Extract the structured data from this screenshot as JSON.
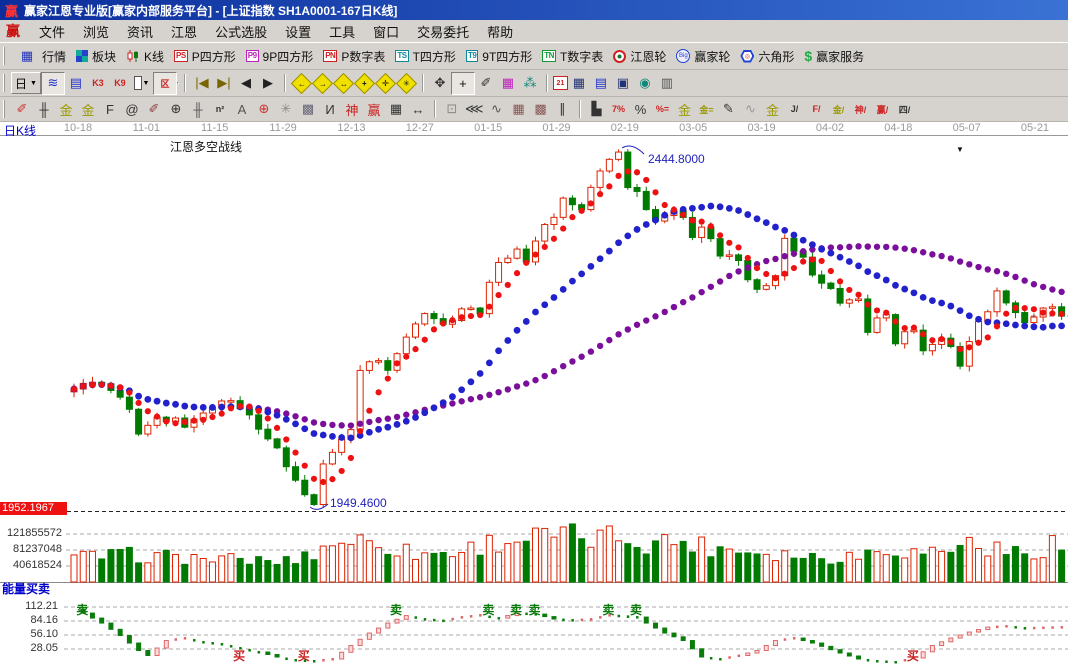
{
  "window": {
    "logo": "赢",
    "title": "赢家江恩专业版[赢家内部服务平台] - [上证指数  SH1A0001-167日K线]"
  },
  "menu": {
    "logo": "赢",
    "items": [
      "文件",
      "浏览",
      "资讯",
      "江恩",
      "公式选股",
      "设置",
      "工具",
      "窗口",
      "交易委托",
      "帮助"
    ]
  },
  "toolbar1": {
    "items": [
      {
        "kind": "glyph",
        "glyph": "▦",
        "color": "#2233bb",
        "label": "行情",
        "name": "quotes"
      },
      {
        "kind": "blocks",
        "label": "板块",
        "name": "sectors"
      },
      {
        "kind": "candles",
        "label": "K线",
        "name": "kline"
      },
      {
        "kind": "box",
        "text": "PS",
        "color": "#cc2222",
        "label": "P四方形",
        "name": "p-square"
      },
      {
        "kind": "box",
        "text": "P9",
        "color": "#bb22bb",
        "label": "9P四方形",
        "name": "9p-square"
      },
      {
        "kind": "box",
        "text": "PN",
        "color": "#cc2222",
        "label": "P数字表",
        "name": "p-number"
      },
      {
        "kind": "box",
        "text": "TS",
        "color": "#118899",
        "label": "T四方形",
        "name": "t-square"
      },
      {
        "kind": "box",
        "text": "T9",
        "color": "#118899",
        "label": "9T四方形",
        "name": "9t-square"
      },
      {
        "kind": "box",
        "text": "TN",
        "color": "#119933",
        "label": "T数字表",
        "name": "t-number"
      },
      {
        "kind": "wheel",
        "label": "江恩轮",
        "name": "gann-wheel"
      },
      {
        "kind": "bigwheel",
        "text": "Big",
        "label": "赢家轮",
        "name": "winner-wheel"
      },
      {
        "kind": "hex",
        "text": "◎",
        "label": "六角形",
        "name": "hexagon"
      },
      {
        "kind": "dollar",
        "text": "$",
        "label": "赢家服务",
        "name": "winner-service"
      }
    ]
  },
  "toolbar2": {
    "period": "日",
    "dropdown": "▼",
    "items": [
      {
        "kind": "period",
        "name": "period-selector"
      },
      {
        "kind": "glyph",
        "glyph": "≋",
        "color": "#2233cc",
        "pressed": true,
        "name": "trend-chart"
      },
      {
        "kind": "glyph",
        "glyph": "▤",
        "color": "#2233cc",
        "name": "info-panel"
      },
      {
        "kind": "glyph",
        "glyph": "K3",
        "color": "#cc2222",
        "small": true,
        "name": "k3-view"
      },
      {
        "kind": "glyph",
        "glyph": "K9",
        "color": "#cc2222",
        "small": true,
        "name": "k9-view"
      },
      {
        "kind": "candledrop",
        "name": "candle-style"
      },
      {
        "kind": "glyph",
        "glyph": "区",
        "color": "#cc2222",
        "small": true,
        "pressed": true,
        "name": "zone-tool"
      },
      {
        "kind": "flag",
        "pressed": true,
        "name": "flag-tool"
      },
      {
        "kind": "sep"
      },
      {
        "kind": "glyph",
        "glyph": "|◀",
        "color": "#776600",
        "name": "go-first"
      },
      {
        "kind": "glyph",
        "glyph": "▶|",
        "color": "#776600",
        "name": "go-last"
      },
      {
        "kind": "glyph",
        "glyph": "◀",
        "color": "#222",
        "name": "prev"
      },
      {
        "kind": "glyph",
        "glyph": "▶",
        "color": "#222",
        "name": "next"
      },
      {
        "kind": "sep"
      },
      {
        "kind": "diamond",
        "glyph": "←",
        "name": "diamond-left"
      },
      {
        "kind": "diamond",
        "glyph": "→",
        "name": "diamond-right"
      },
      {
        "kind": "diamond",
        "glyph": "↔",
        "name": "diamond-expand"
      },
      {
        "kind": "diamond",
        "glyph": "+",
        "name": "diamond-plus"
      },
      {
        "kind": "diamond",
        "glyph": "✛",
        "name": "diamond-cross"
      },
      {
        "kind": "diamond",
        "glyph": "✳",
        "name": "diamond-star"
      },
      {
        "kind": "sep"
      },
      {
        "kind": "glyph",
        "glyph": "✥",
        "color": "#333",
        "name": "hand-tool"
      },
      {
        "kind": "glyph",
        "glyph": "+",
        "color": "#111",
        "pressed": true,
        "name": "crosshair-tool"
      },
      {
        "kind": "glyph",
        "glyph": "✐",
        "color": "#333",
        "name": "lasso-tool"
      },
      {
        "kind": "glyph",
        "glyph": "▦",
        "color": "#bb22bb",
        "name": "pattern-tool"
      },
      {
        "kind": "glyph",
        "glyph": "⁂",
        "color": "#118877",
        "name": "group-tool"
      },
      {
        "kind": "sep"
      },
      {
        "kind": "calendar",
        "text": "21",
        "name": "calendar"
      },
      {
        "kind": "glyph",
        "glyph": "▦",
        "color": "#223377",
        "name": "calculator"
      },
      {
        "kind": "glyph",
        "glyph": "▤",
        "color": "#2233cc",
        "name": "notepad"
      },
      {
        "kind": "glyph",
        "glyph": "▣",
        "color": "#223377",
        "name": "save"
      },
      {
        "kind": "glyph",
        "glyph": "◉",
        "color": "#118877",
        "name": "export"
      },
      {
        "kind": "glyph",
        "glyph": "▥",
        "color": "#555",
        "name": "print"
      }
    ]
  },
  "toolbar3": {
    "items": [
      {
        "kind": "glyph",
        "glyph": "✐",
        "color": "#cc3333",
        "name": "draw-pen"
      },
      {
        "kind": "glyph",
        "glyph": "╫",
        "color": "#333",
        "name": "draw-ruler"
      },
      {
        "kind": "glyph",
        "glyph": "金",
        "color": "#999900",
        "name": "draw-gold-grid1"
      },
      {
        "kind": "glyph",
        "glyph": "金",
        "color": "#999900",
        "name": "draw-gold-grid2"
      },
      {
        "kind": "glyph",
        "glyph": "F",
        "color": "#333",
        "name": "draw-f-grid"
      },
      {
        "kind": "glyph",
        "glyph": "@",
        "color": "#333",
        "name": "draw-spiral"
      },
      {
        "kind": "glyph",
        "glyph": "✐",
        "color": "#884444",
        "name": "draw-pen2"
      },
      {
        "kind": "glyph",
        "glyph": "⊕",
        "color": "#333",
        "name": "draw-circle-cross"
      },
      {
        "kind": "glyph",
        "glyph": "╫",
        "color": "#555",
        "name": "draw-ruler2"
      },
      {
        "kind": "glyph",
        "glyph": "n²",
        "color": "#333",
        "small": true,
        "name": "draw-n2"
      },
      {
        "kind": "glyph",
        "glyph": "A",
        "color": "#555",
        "name": "draw-a-line"
      },
      {
        "kind": "glyph",
        "glyph": "⊕",
        "color": "#cc3333",
        "name": "draw-target"
      },
      {
        "kind": "glyph",
        "glyph": "✳",
        "color": "#888",
        "name": "draw-star-grid"
      },
      {
        "kind": "glyph",
        "glyph": "▩",
        "color": "#666677",
        "name": "draw-box-grid"
      },
      {
        "kind": "glyph",
        "glyph": "И",
        "color": "#333",
        "name": "draw-n-mark"
      },
      {
        "kind": "glyph",
        "glyph": "神",
        "color": "#cc2222",
        "name": "draw-shen"
      },
      {
        "kind": "glyph",
        "glyph": "赢",
        "color": "#cc2222",
        "name": "draw-ying"
      },
      {
        "kind": "glyph",
        "glyph": "▦",
        "color": "#333",
        "name": "draw-dense-grid"
      },
      {
        "kind": "glyph",
        "glyph": "↔",
        "color": "#333",
        "name": "draw-h-arrow"
      },
      {
        "kind": "sep"
      },
      {
        "kind": "glyph",
        "glyph": "⊡",
        "color": "#888",
        "name": "draw-box-tool"
      },
      {
        "kind": "glyph",
        "glyph": "⋘",
        "color": "#333",
        "name": "draw-fan"
      },
      {
        "kind": "glyph",
        "glyph": "∿",
        "color": "#555",
        "name": "draw-wave"
      },
      {
        "kind": "glyph",
        "glyph": "▦",
        "color": "#885555",
        "name": "draw-grid3"
      },
      {
        "kind": "glyph",
        "glyph": "▩",
        "color": "#885555",
        "name": "draw-grid4"
      },
      {
        "kind": "glyph",
        "glyph": "∥",
        "color": "#333",
        "name": "draw-parallel"
      },
      {
        "kind": "sep"
      },
      {
        "kind": "glyph",
        "glyph": "▙",
        "color": "#333",
        "name": "tool-bar-chart"
      },
      {
        "kind": "glyph",
        "glyph": "7%",
        "color": "#cc2222",
        "small": true,
        "name": "tool-7pct"
      },
      {
        "kind": "glyph",
        "glyph": "%",
        "color": "#333",
        "name": "tool-pct"
      },
      {
        "kind": "glyph",
        "glyph": "%=",
        "color": "#cc2222",
        "small": true,
        "name": "tool-pct-line"
      },
      {
        "kind": "glyph",
        "glyph": "金",
        "color": "#999900",
        "name": "tool-gold-circle"
      },
      {
        "kind": "glyph",
        "glyph": "金=",
        "color": "#999900",
        "small": true,
        "name": "tool-gold-lines"
      },
      {
        "kind": "glyph",
        "glyph": "✎",
        "color": "#333",
        "name": "tool-pen3"
      },
      {
        "kind": "glyph",
        "glyph": "∿",
        "color": "#999",
        "name": "tool-av"
      },
      {
        "kind": "glyph",
        "glyph": "金",
        "color": "#999900",
        "name": "tool-gold"
      },
      {
        "kind": "glyph",
        "glyph": "J/",
        "color": "#333",
        "small": true,
        "name": "tool-j-angle"
      },
      {
        "kind": "glyph",
        "glyph": "F/",
        "color": "#cc2222",
        "small": true,
        "name": "tool-f-angle"
      },
      {
        "kind": "glyph",
        "glyph": "金/",
        "color": "#999900",
        "small": true,
        "name": "tool-gold-angle"
      },
      {
        "kind": "glyph",
        "glyph": "神/",
        "color": "#cc2222",
        "small": true,
        "name": "tool-shen-angle"
      },
      {
        "kind": "glyph",
        "glyph": "赢/",
        "color": "#cc2222",
        "small": true,
        "name": "tool-ying-angle"
      },
      {
        "kind": "glyph",
        "glyph": "四/",
        "color": "#333",
        "small": true,
        "name": "tool-si-angle"
      }
    ]
  },
  "chart_header": {
    "kline_label": "日K线",
    "dates": [
      "10-18",
      "11-01",
      "11-15",
      "11-29",
      "12-13",
      "12-27",
      "01-15",
      "01-29",
      "02-19",
      "03-05",
      "03-19",
      "04-02",
      "04-18",
      "05-07",
      "05-21"
    ]
  },
  "main_chart": {
    "pane_label": "江恩多空战线",
    "peak_annotation": "2444.8000",
    "trough_annotation": "1949.4600",
    "axis_highlight": "1952.1967",
    "corner_icon": "▼"
  },
  "volume_pane": {
    "axis_labels": [
      "121855572",
      "81237048",
      "40618524"
    ]
  },
  "indicator_pane": {
    "label": "能量买卖",
    "axis_labels": [
      "112.21",
      "84.16",
      "56.10",
      "28.05"
    ],
    "sell_label": "卖",
    "buy_label": "买"
  },
  "colors": {
    "up": "#dd2200",
    "down": "#007a00",
    "ma_fast": "#ee1111",
    "ma_mid": "#2222cc",
    "ma_slow": "#7b0f9b",
    "annotation": "#2222bb",
    "highlight_bg": "#ee1111",
    "osc_up_fill": "#ffdddd",
    "osc_up_stroke": "#dd6666",
    "osc_down": "#0b7d0b",
    "sell": "#0a7a0a",
    "buy": "#cc2222",
    "grid": "#aaaaaa",
    "level_line": "#222222"
  },
  "chart_data": {
    "type": "candlestick",
    "symbol": "上证指数 SH1A0001",
    "period": "167日K线",
    "price_annotations": {
      "peak": 2444.8,
      "trough": 1949.46,
      "axis_highlight": 1952.1967
    },
    "n_candles": 108,
    "price_range": [
      1941,
      2455
    ],
    "close_anchors": [
      [
        0,
        2112
      ],
      [
        2,
        2126
      ],
      [
        5,
        2100
      ],
      [
        7,
        2052
      ],
      [
        9,
        2070
      ],
      [
        12,
        2062
      ],
      [
        15,
        2088
      ],
      [
        17,
        2096
      ],
      [
        19,
        2076
      ],
      [
        22,
        2026
      ],
      [
        24,
        1985
      ],
      [
        26,
        1952
      ],
      [
        27,
        2002
      ],
      [
        28,
        2028
      ],
      [
        30,
        2058
      ],
      [
        31,
        2142
      ],
      [
        33,
        2152
      ],
      [
        34,
        2136
      ],
      [
        36,
        2188
      ],
      [
        38,
        2216
      ],
      [
        40,
        2200
      ],
      [
        42,
        2225
      ],
      [
        44,
        2218
      ],
      [
        46,
        2290
      ],
      [
        48,
        2305
      ],
      [
        49,
        2290
      ],
      [
        51,
        2340
      ],
      [
        53,
        2376
      ],
      [
        55,
        2360
      ],
      [
        57,
        2420
      ],
      [
        59,
        2441
      ],
      [
        60,
        2392
      ],
      [
        62,
        2366
      ],
      [
        63,
        2344
      ],
      [
        65,
        2362
      ],
      [
        67,
        2322
      ],
      [
        68,
        2340
      ],
      [
        70,
        2300
      ],
      [
        72,
        2286
      ],
      [
        74,
        2250
      ],
      [
        76,
        2270
      ],
      [
        77,
        2316
      ],
      [
        79,
        2290
      ],
      [
        81,
        2260
      ],
      [
        83,
        2230
      ],
      [
        85,
        2240
      ],
      [
        86,
        2195
      ],
      [
        88,
        2215
      ],
      [
        89,
        2175
      ],
      [
        91,
        2200
      ],
      [
        92,
        2165
      ],
      [
        94,
        2180
      ],
      [
        96,
        2150
      ],
      [
        98,
        2205
      ],
      [
        100,
        2240
      ],
      [
        101,
        2235
      ],
      [
        103,
        2205
      ],
      [
        104,
        2215
      ],
      [
        106,
        2225
      ],
      [
        107,
        2218
      ]
    ],
    "ma_windows": {
      "fast": 5,
      "mid": 20,
      "slow": 45
    },
    "volume_axis": [
      121855572,
      81237048,
      40618524
    ],
    "volume_envelope": [
      [
        0,
        0.5
      ],
      [
        6,
        0.55
      ],
      [
        12,
        0.5
      ],
      [
        18,
        0.45
      ],
      [
        23,
        0.42
      ],
      [
        26,
        0.6
      ],
      [
        29,
        0.88
      ],
      [
        33,
        0.8
      ],
      [
        37,
        0.58
      ],
      [
        41,
        0.6
      ],
      [
        45,
        0.8
      ],
      [
        49,
        0.9
      ],
      [
        53,
        0.95
      ],
      [
        56,
        0.88
      ],
      [
        59,
        0.95
      ],
      [
        62,
        0.8
      ],
      [
        65,
        0.85
      ],
      [
        69,
        0.72
      ],
      [
        73,
        0.65
      ],
      [
        77,
        0.58
      ],
      [
        81,
        0.5
      ],
      [
        85,
        0.55
      ],
      [
        88,
        0.72
      ],
      [
        91,
        0.6
      ],
      [
        94,
        0.65
      ],
      [
        97,
        0.8
      ],
      [
        99,
        0.7
      ],
      [
        101,
        0.62
      ],
      [
        103,
        0.58
      ],
      [
        105,
        0.7
      ],
      [
        106,
        0.85
      ],
      [
        107,
        0.72
      ]
    ],
    "indicator": {
      "name": "能量买卖",
      "axis": [
        112.21,
        84.16,
        56.1,
        28.05
      ],
      "value_anchors": [
        [
          0,
          108
        ],
        [
          1,
          100
        ],
        [
          3,
          80
        ],
        [
          5,
          55
        ],
        [
          7,
          25
        ],
        [
          8,
          15
        ],
        [
          10,
          45
        ],
        [
          12,
          50
        ],
        [
          14,
          42
        ],
        [
          16,
          38
        ],
        [
          18,
          30
        ],
        [
          20,
          22
        ],
        [
          22,
          12
        ],
        [
          24,
          6
        ],
        [
          26,
          4
        ],
        [
          28,
          8
        ],
        [
          30,
          35
        ],
        [
          32,
          60
        ],
        [
          34,
          80
        ],
        [
          36,
          95
        ],
        [
          38,
          88
        ],
        [
          40,
          85
        ],
        [
          42,
          92
        ],
        [
          44,
          96
        ],
        [
          46,
          90
        ],
        [
          48,
          100
        ],
        [
          50,
          98
        ],
        [
          52,
          88
        ],
        [
          54,
          86
        ],
        [
          56,
          88
        ],
        [
          58,
          96
        ],
        [
          61,
          92
        ],
        [
          62,
          80
        ],
        [
          64,
          60
        ],
        [
          66,
          45
        ],
        [
          68,
          12
        ],
        [
          70,
          8
        ],
        [
          72,
          15
        ],
        [
          74,
          25
        ],
        [
          76,
          45
        ],
        [
          78,
          50
        ],
        [
          80,
          40
        ],
        [
          83,
          20
        ],
        [
          85,
          8
        ],
        [
          87,
          4
        ],
        [
          89,
          2
        ],
        [
          91,
          10
        ],
        [
          93,
          35
        ],
        [
          95,
          50
        ],
        [
          97,
          62
        ],
        [
          99,
          72
        ],
        [
          101,
          74
        ],
        [
          103,
          70
        ],
        [
          107,
          72
        ]
      ],
      "sell_indices": [
        1,
        35,
        45,
        48,
        50,
        58,
        61
      ],
      "buy_indices": [
        18,
        25,
        91
      ]
    }
  }
}
